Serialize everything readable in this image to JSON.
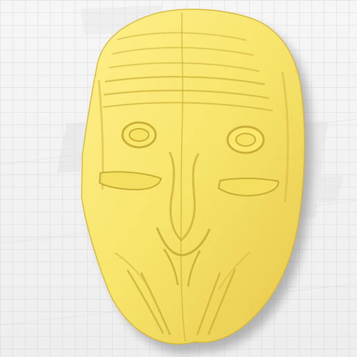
{
  "viewport": {
    "label": "",
    "model_color": "#f7e46b",
    "model_shade": "#d9bf3f",
    "grid_color": "#d6d6d6",
    "background": "#f3f3f3",
    "shadow_color": "#8b8b8b"
  },
  "scene": {
    "object": "3d-mask-model",
    "grid_visible": true,
    "watermark_visible": true
  }
}
